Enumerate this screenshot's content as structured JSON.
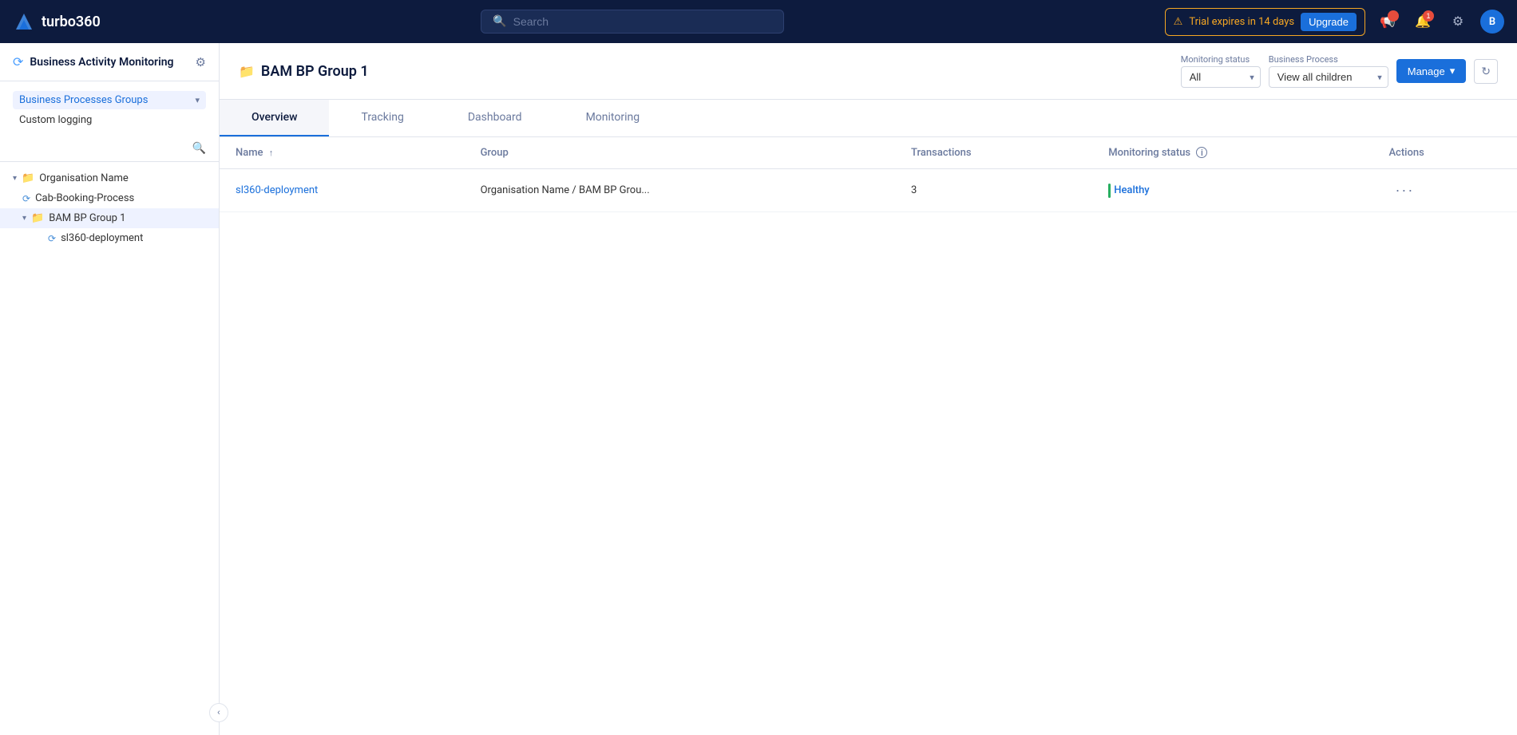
{
  "app": {
    "name": "turbo360"
  },
  "navbar": {
    "search_placeholder": "Search",
    "trial_text": "Trial expires in 14 days",
    "upgrade_label": "Upgrade",
    "user_initial": "B"
  },
  "sidebar": {
    "title": "Business Activity Monitoring",
    "nav_items": [
      {
        "id": "business-processes-groups",
        "label": "Business Processes Groups"
      },
      {
        "id": "custom-logging",
        "label": "Custom logging"
      }
    ],
    "tree": [
      {
        "id": "org",
        "label": "Organisation Name",
        "level": 0,
        "type": "root",
        "expanded": true
      },
      {
        "id": "cab",
        "label": "Cab-Booking-Process",
        "level": 1,
        "type": "process"
      },
      {
        "id": "bam-group",
        "label": "BAM BP Group 1",
        "level": 1,
        "type": "folder",
        "expanded": true,
        "selected": true
      },
      {
        "id": "sl360",
        "label": "sl360-deployment",
        "level": 2,
        "type": "process"
      }
    ]
  },
  "content": {
    "page_title": "BAM BP Group 1",
    "monitoring_status_label": "Monitoring status",
    "monitoring_status_value": "All",
    "business_process_label": "Business Process",
    "business_process_value": "View all children",
    "manage_label": "Manage",
    "tabs": [
      {
        "id": "overview",
        "label": "Overview",
        "active": true
      },
      {
        "id": "tracking",
        "label": "Tracking"
      },
      {
        "id": "dashboard",
        "label": "Dashboard"
      },
      {
        "id": "monitoring",
        "label": "Monitoring"
      }
    ],
    "table": {
      "columns": [
        {
          "id": "name",
          "label": "Name",
          "sortable": true
        },
        {
          "id": "group",
          "label": "Group",
          "sortable": false
        },
        {
          "id": "transactions",
          "label": "Transactions",
          "sortable": false
        },
        {
          "id": "monitoring_status",
          "label": "Monitoring status",
          "sortable": false,
          "info": true
        },
        {
          "id": "actions",
          "label": "Actions",
          "sortable": false
        }
      ],
      "rows": [
        {
          "name": "sl360-deployment",
          "group": "Organisation Name / BAM BP Grou...",
          "transactions": "3",
          "monitoring_status": "Healthy",
          "status_type": "healthy"
        }
      ]
    }
  }
}
